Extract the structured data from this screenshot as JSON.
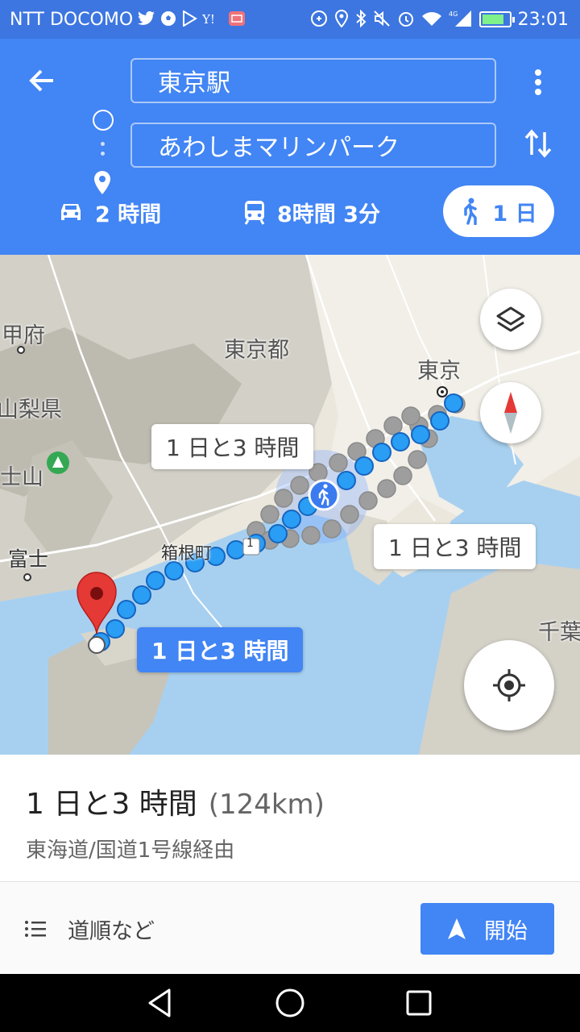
{
  "status_bar": {
    "carrier": "NTT DOCOMO",
    "network": "4G",
    "time": "23:01",
    "icons_left": [
      "twitter-icon",
      "soccer-ball-icon",
      "play-store-icon",
      "yahoo-icon",
      "mail-icon"
    ],
    "icons_right": [
      "data-saver-icon",
      "location-icon",
      "bluetooth-icon",
      "mute-icon",
      "alarm-icon",
      "wifi-icon",
      "signal-icon",
      "battery-icon"
    ],
    "colors": {
      "bar": "#3d76e0"
    }
  },
  "header": {
    "origin": "東京駅",
    "destination": "あわしまマリンパーク",
    "colors": {
      "background": "#4285f4"
    }
  },
  "modes": [
    {
      "icon": "car-icon",
      "label": "2 時間",
      "selected": false
    },
    {
      "icon": "train-icon",
      "label": "8時間 3分",
      "selected": false
    },
    {
      "icon": "walk-icon",
      "label": "1 日",
      "selected": true
    }
  ],
  "map": {
    "labels": {
      "kofu": "甲府",
      "tokyo_to": "東京都",
      "tokyo": "東京",
      "yamanashi": "山梨県",
      "fujisan": "士山",
      "fuji": "富士",
      "hakone": "箱根町",
      "chiba": "千葉"
    },
    "route_number": "1",
    "bubbles": {
      "upper": "1 日と3 時間",
      "right": "1 日と3 時間",
      "selected": "1 日と3 時間"
    },
    "colors": {
      "route_active": "#2a9df4",
      "route_alt": "#9e9e9e",
      "sea": "#a7d0f0",
      "pin": "#e53935"
    }
  },
  "summary": {
    "duration": "1 日と3 時間",
    "distance": "(124km)",
    "via": "東海道/国道1号線経由"
  },
  "actions": {
    "steps_label": "道順など",
    "start_label": "開始"
  }
}
